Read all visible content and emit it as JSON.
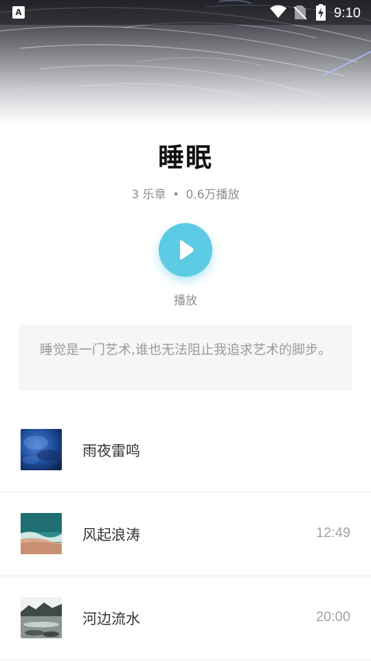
{
  "status_bar": {
    "app_badge": "A",
    "time": "9:10",
    "icons": [
      "wifi-icon",
      "no-sim-icon",
      "battery-charging-icon"
    ]
  },
  "album": {
    "title": "睡眠",
    "chapters": "3 乐章",
    "separator": "•",
    "plays": "0.6万播放",
    "play_label": "播放",
    "description": "睡觉是一门艺术,谁也无法阻止我追求艺术的脚步。"
  },
  "tracks": [
    {
      "name": "雨夜雷鸣",
      "duration": ""
    },
    {
      "name": "风起浪涛",
      "duration": "12:49"
    },
    {
      "name": "河边流水",
      "duration": "20:00"
    }
  ],
  "colors": {
    "accent": "#5dcbe3",
    "title": "#111111",
    "muted": "#8e8e8e",
    "panel": "#f6f6f6"
  }
}
